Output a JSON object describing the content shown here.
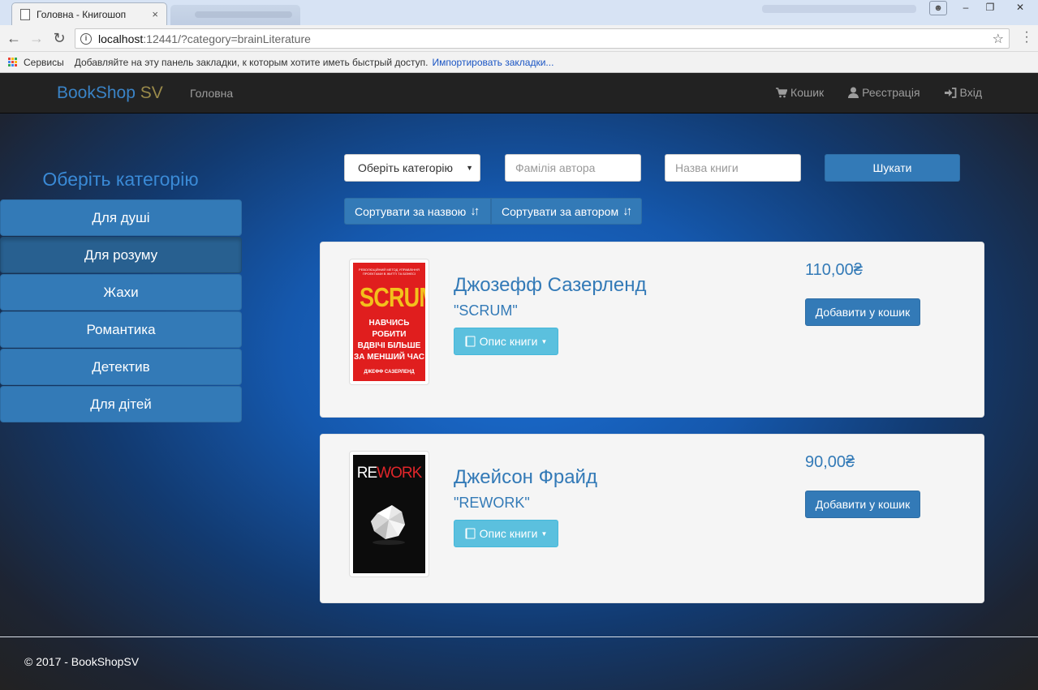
{
  "browser": {
    "tab_title": "Головна - Книгошоп",
    "url_host": "localhost",
    "url_path": ":12441/?category=brainLiterature",
    "bookmarks": {
      "services": "Сервисы",
      "hint": "Добавляйте на эту панель закладки, к которым хотите иметь быстрый доступ.",
      "import_link": "Импортировать закладки..."
    }
  },
  "navbar": {
    "brand_main": "BookShop",
    "brand_suffix": "SV",
    "home": "Головна",
    "cart": "Кошик",
    "register": "Реєстрація",
    "login": "Вхід"
  },
  "sidebar": {
    "title": "Оберіть категорію",
    "categories": [
      {
        "label": "Для душі",
        "active": false
      },
      {
        "label": "Для розуму",
        "active": true
      },
      {
        "label": "Жахи",
        "active": false
      },
      {
        "label": "Романтика",
        "active": false
      },
      {
        "label": "Детектив",
        "active": false
      },
      {
        "label": "Для дітей",
        "active": false
      }
    ]
  },
  "filters": {
    "category_select": "Оберіть категорію",
    "author_placeholder": "Фамілія автора",
    "title_placeholder": "Назва книги",
    "search_button": "Шукати",
    "sort_by_title": "Сортувати за назвою",
    "sort_by_author": "Сортувати за автором"
  },
  "books": [
    {
      "author": "Джозефф Сазерленд",
      "title": "\"SCRUM\"",
      "description_button": "Опис книги",
      "price": "110,00₴",
      "add_button": "Добавити у кошик",
      "cover": {
        "tagline": "РЕВОЛЮЦІЙНИЙ МЕТОД УПРАВЛІННЯ ПРОЕКТАМИ В ЖИТТІ ТА БІЗНЕСІ",
        "title": "SCRUM",
        "subtitle_lines": [
          "НАВЧИСЬ РОБИТИ",
          "ВДВІЧІ БІЛЬШЕ",
          "ЗА МЕНШИЙ ЧАС"
        ],
        "author": "ДЖЕФФ САЗЕРЛЕНД"
      }
    },
    {
      "author": "Джейсон Фрайд",
      "title": "\"REWORK\"",
      "description_button": "Опис книги",
      "price": "90,00₴",
      "add_button": "Добавити у кошик",
      "cover": {
        "title_re": "RE",
        "title_work": "WORK"
      }
    }
  ],
  "footer": {
    "copyright": "© 2017 - BookShopSV"
  },
  "colors": {
    "primary": "#337ab7",
    "info": "#5bc0de",
    "navbar": "#222222",
    "brand_suffix": "#9a8a4a"
  }
}
